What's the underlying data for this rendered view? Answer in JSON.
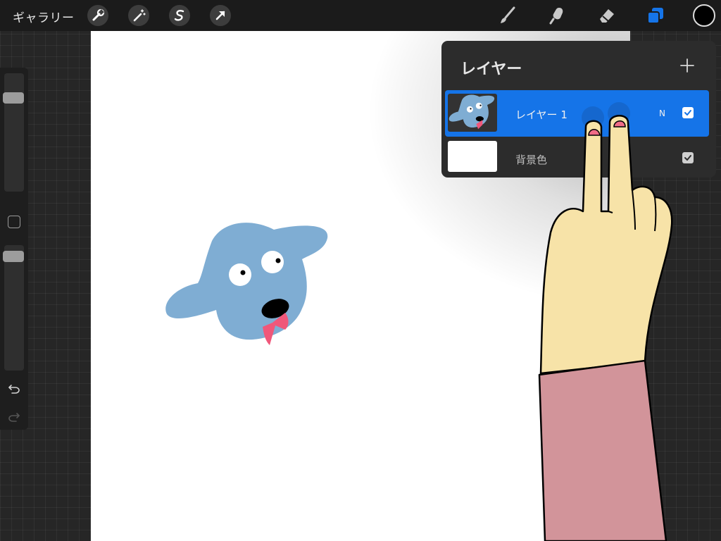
{
  "toolbar": {
    "gallery_label": "ギャラリー",
    "left_tools": [
      "wrench-icon",
      "magic-wand-icon",
      "selection-icon",
      "transform-arrow-icon"
    ],
    "right_tools": [
      "brush-icon",
      "smudge-icon",
      "eraser-icon",
      "layers-icon"
    ],
    "active_tool": "layers-icon",
    "accent_color": "#1574e8",
    "current_color": "#000000"
  },
  "sidebar": {
    "size_slider_value": 0.82,
    "opacity_slider_value": 0.95,
    "undo_icon": "undo-icon",
    "redo_icon": "redo-icon"
  },
  "layers": {
    "title": "レイヤー",
    "add_icon": "plus-icon",
    "items": [
      {
        "name": "レイヤー 1",
        "blend_mode": "N",
        "visible": true,
        "selected": true
      },
      {
        "name": "背景色",
        "blend_mode": "",
        "visible": true,
        "selected": false
      }
    ]
  },
  "artwork": {
    "dog_color": "#7fadd3",
    "bow_color": "#f0577a",
    "canvas_color": "#ffffff"
  }
}
